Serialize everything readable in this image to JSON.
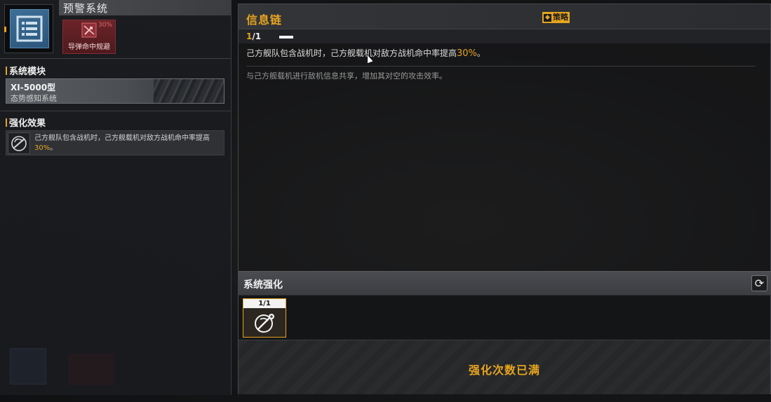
{
  "system": {
    "title": "预警系统",
    "skill": {
      "label": "导弹命中规避",
      "percent": "30%"
    }
  },
  "module_section": {
    "title": "系统模块",
    "module_name": "XI-5000型",
    "module_sub": "态势感知系统"
  },
  "effect_section": {
    "title": "强化效果",
    "text_main": "己方舰队包含战机时，己方舰载机对敌方战机命中率提高",
    "text_pct": "30%",
    "text_end": "。"
  },
  "info": {
    "title": "信息链",
    "strategy_label": "策略",
    "level_current": "1",
    "level_total": "/1",
    "desc_main": "己方舰队包含战机时，己方舰载机对敌方战机命中率提高",
    "desc_pct": "30%",
    "desc_end": "。",
    "flavor": "与己方舰载机进行敌机信息共享，增加其对空的攻击效率。"
  },
  "enhance": {
    "title": "系统强化",
    "item_level": "1/1",
    "status": "强化次数已满"
  },
  "colors": {
    "accent": "#e6a41f",
    "skill_red": "#6b2328",
    "icon_blue": "#3d6f96"
  }
}
